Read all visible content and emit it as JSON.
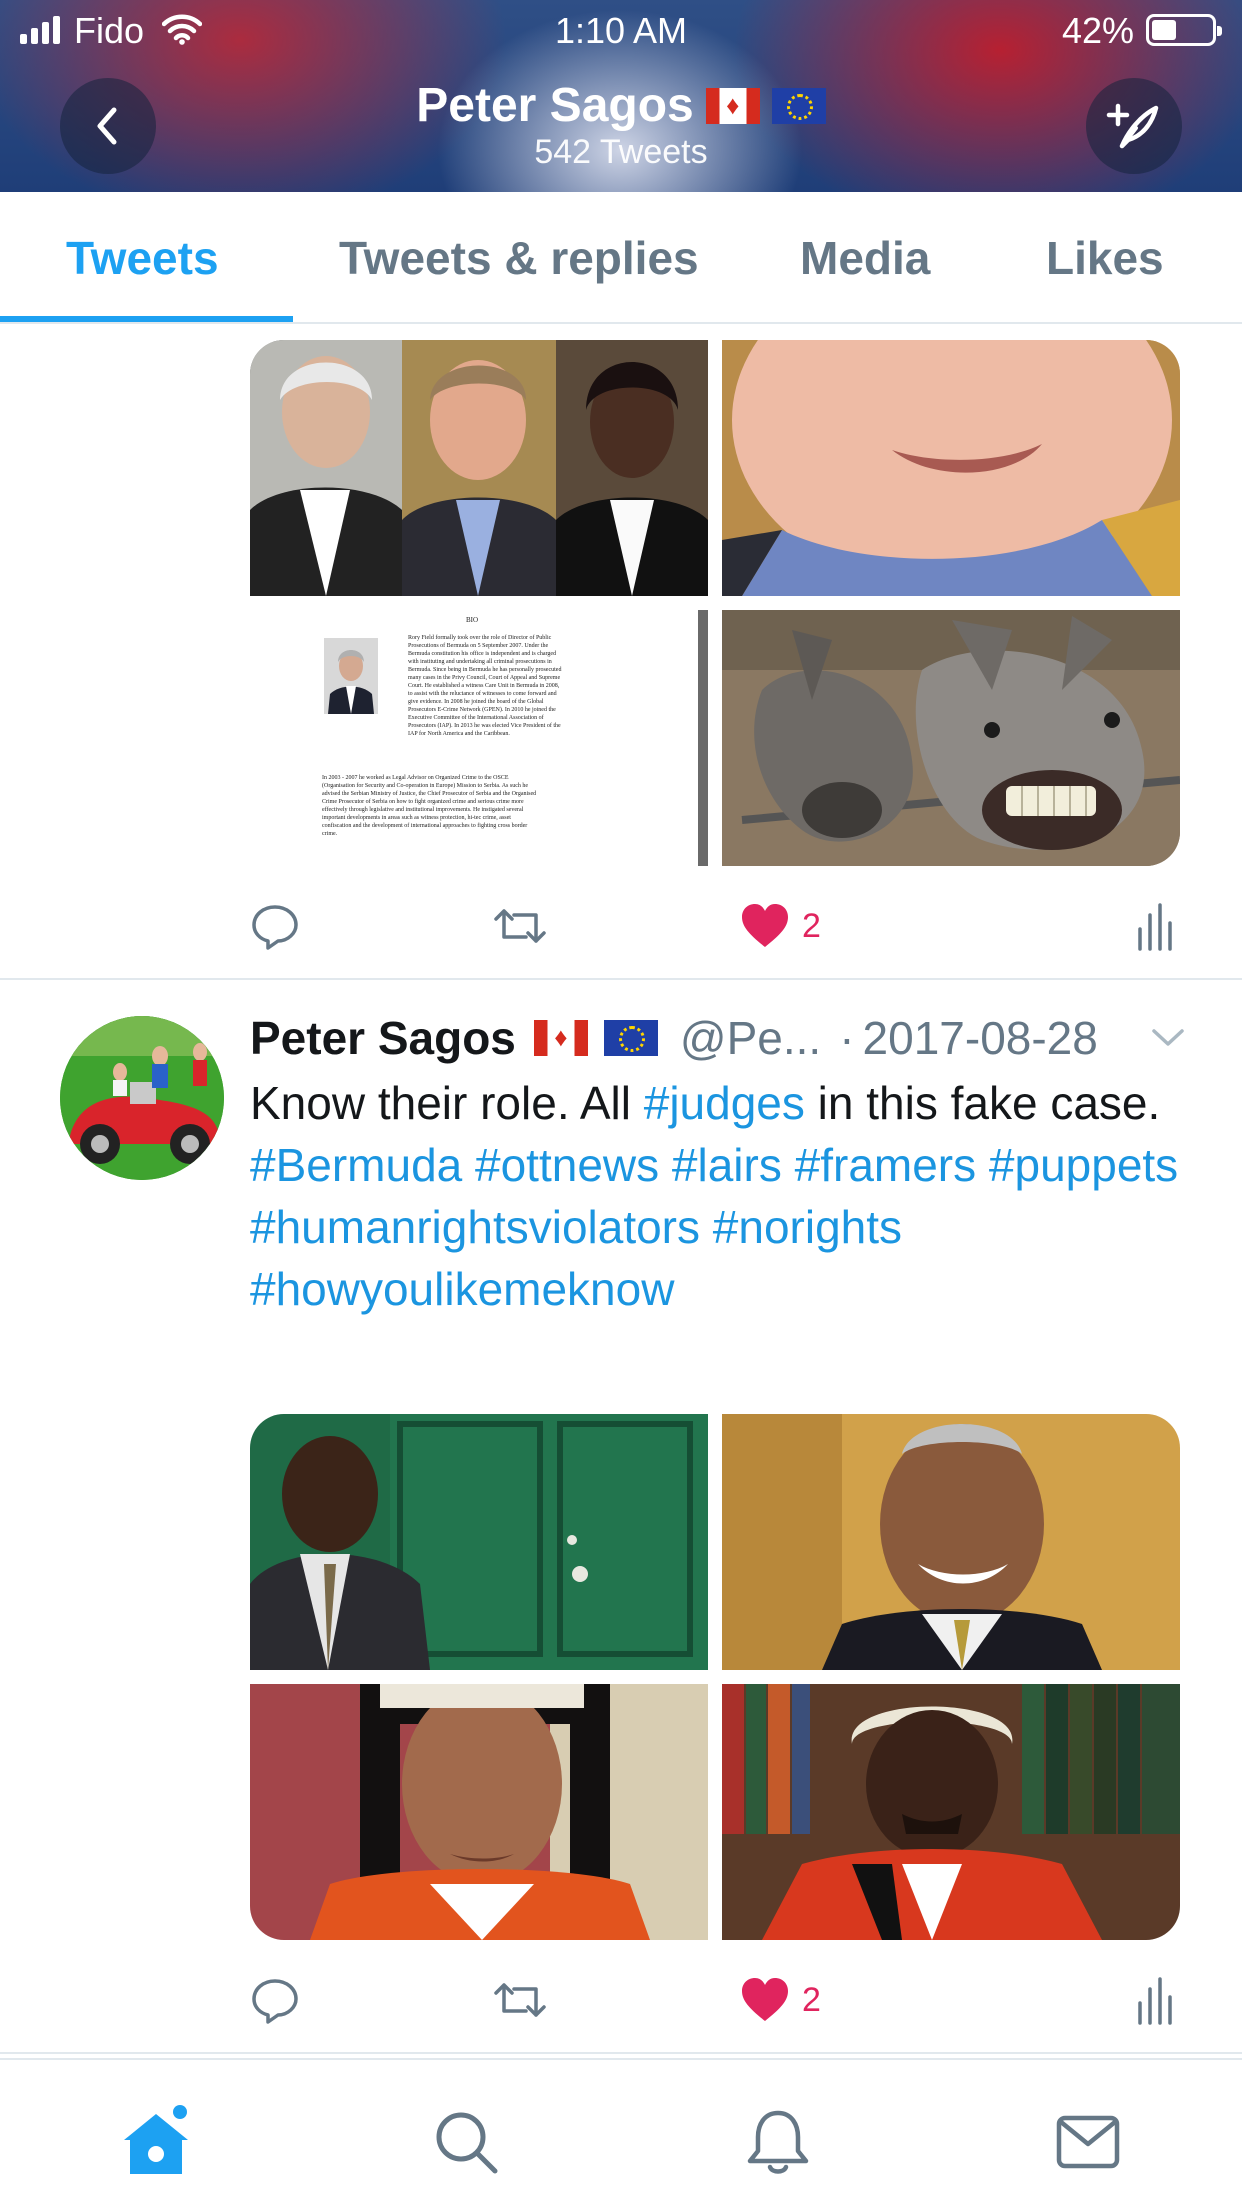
{
  "status_bar": {
    "carrier": "Fido",
    "time": "1:10 AM",
    "battery_percent": "42%",
    "battery_level": 0.42
  },
  "header": {
    "name": "Peter Sagos",
    "tweet_count": "542 Tweets",
    "back_icon": "chevron-left-icon",
    "compose_icon": "compose-tweet-icon"
  },
  "tabs": [
    {
      "label": "Tweets",
      "active": true
    },
    {
      "label": "Tweets & replies",
      "active": false
    },
    {
      "label": "Media",
      "active": false
    },
    {
      "label": "Likes",
      "active": false
    }
  ],
  "tweet_1": {
    "media": {
      "bio_heading": "BIO",
      "bio_lines": [
        "Rory Field formally took over the role of Director of Public",
        "Prosecutions of Bermuda on 5 September 2007. Under the",
        "Bermuda constitution his office is independent and is charged",
        "with instituting and undertaking all criminal prosecutions in",
        "Bermuda. Since being in Bermuda he has personally prosecuted",
        "many cases in the Privy Council, Court of Appeal and Supreme",
        "Court. He established a witness Care Unit in Bermuda in 2008,",
        "to assist with the reluctance of witnesses to come forward and",
        "give evidence. In 2008 he joined the board of the Global",
        "Prosecutors E-Crime Network (GPEN). In 2010 he joined the",
        "Executive Committee of the International Association of",
        "Prosecutors (IAP). In 2013 he was elected Vice President of the",
        "IAP for North America and the Caribbean."
      ],
      "bio_paragraph_2": [
        "In 2003 - 2007 he worked as Legal Advisor on Organized Crime to the OSCE",
        "(Organisation for Security and Co-operation in Europe) Mission to Serbia. As such he",
        "advised the Serbian Ministry of Justice, the Chief Prosecutor of Serbia and the Organised",
        "Crime Prosecutor of Serbia on how to fight organized crime and serious crime more",
        "effectively through legislative and institutional improvements. He instigated several",
        "important developments in areas such as witness protection, hi-tec crime, asset",
        "confiscation and the development of international approaches to fighting cross border",
        "crime."
      ]
    },
    "like_count": "2"
  },
  "tweet_2": {
    "author_name": "Peter Sagos",
    "handle": "@Pe...",
    "separator": "·",
    "date": "2017-08-28",
    "text_segments": [
      {
        "text": "Know their role. All ",
        "tag": false
      },
      {
        "text": "#judges",
        "tag": true
      },
      {
        "text": " in this fake case. ",
        "tag": false
      },
      {
        "text": "#Bermuda",
        "tag": true
      },
      {
        "text": " ",
        "tag": false
      },
      {
        "text": "#ottnews",
        "tag": true
      },
      {
        "text": " ",
        "tag": false
      },
      {
        "text": "#lairs",
        "tag": true
      },
      {
        "text": " ",
        "tag": false
      },
      {
        "text": "#framers",
        "tag": true
      },
      {
        "text": " ",
        "tag": false
      },
      {
        "text": "#puppets",
        "tag": true
      },
      {
        "text": " ",
        "tag": false
      },
      {
        "text": "#humanrightsviolators",
        "tag": true
      },
      {
        "text": " ",
        "tag": false
      },
      {
        "text": "#norights",
        "tag": true
      },
      {
        "text": " ",
        "tag": false
      },
      {
        "text": "#howyoulikemeknow",
        "tag": true
      }
    ],
    "like_count": "2"
  },
  "colors": {
    "accent": "#1da1f2",
    "hashtag": "#1b95e0",
    "like": "#e0245e",
    "secondary_text": "#657786",
    "divider": "#e1e8ed"
  },
  "bottom_nav": [
    {
      "icon": "home-icon",
      "active": true,
      "has_dot": true
    },
    {
      "icon": "search-icon",
      "active": false
    },
    {
      "icon": "notifications-bell-icon",
      "active": false
    },
    {
      "icon": "messages-envelope-icon",
      "active": false
    }
  ]
}
